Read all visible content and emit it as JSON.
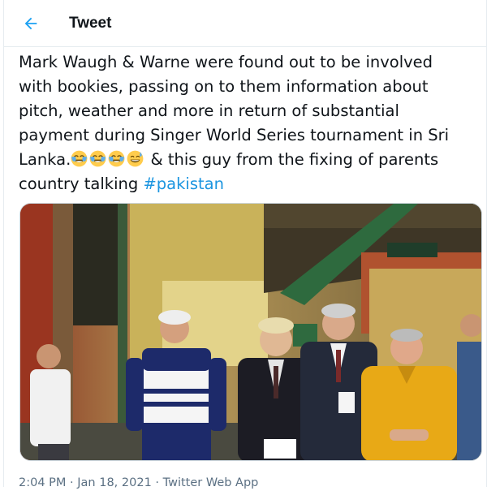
{
  "header": {
    "title": "Tweet",
    "back_icon": "arrow-left-icon",
    "accent": "#1da1f2"
  },
  "tweet": {
    "lines": [
      "Mark Waugh & Warne were found out to be involved",
      "with bookies, passing on to them information about",
      "pitch, weather and more in return of substantial",
      "payment during Singer World Series tournament in Sri"
    ],
    "line5_start": "Lanka.",
    "emojis": [
      "face-with-tears-of-joy",
      "face-with-tears-of-joy",
      "face-with-tears-of-joy",
      "grinning-face-with-sweat"
    ],
    "line5_end": " & this guy from the fixing of parents",
    "line6_start": "country talking ",
    "hashtag": "#pakistan",
    "hashtag_color": "#1b95e0"
  },
  "media": {
    "description_icon": "photo-cricketers"
  },
  "meta": {
    "time": "2:04 PM",
    "separator": " · ",
    "date": "Jan 18, 2021",
    "source": "Twitter Web App"
  }
}
